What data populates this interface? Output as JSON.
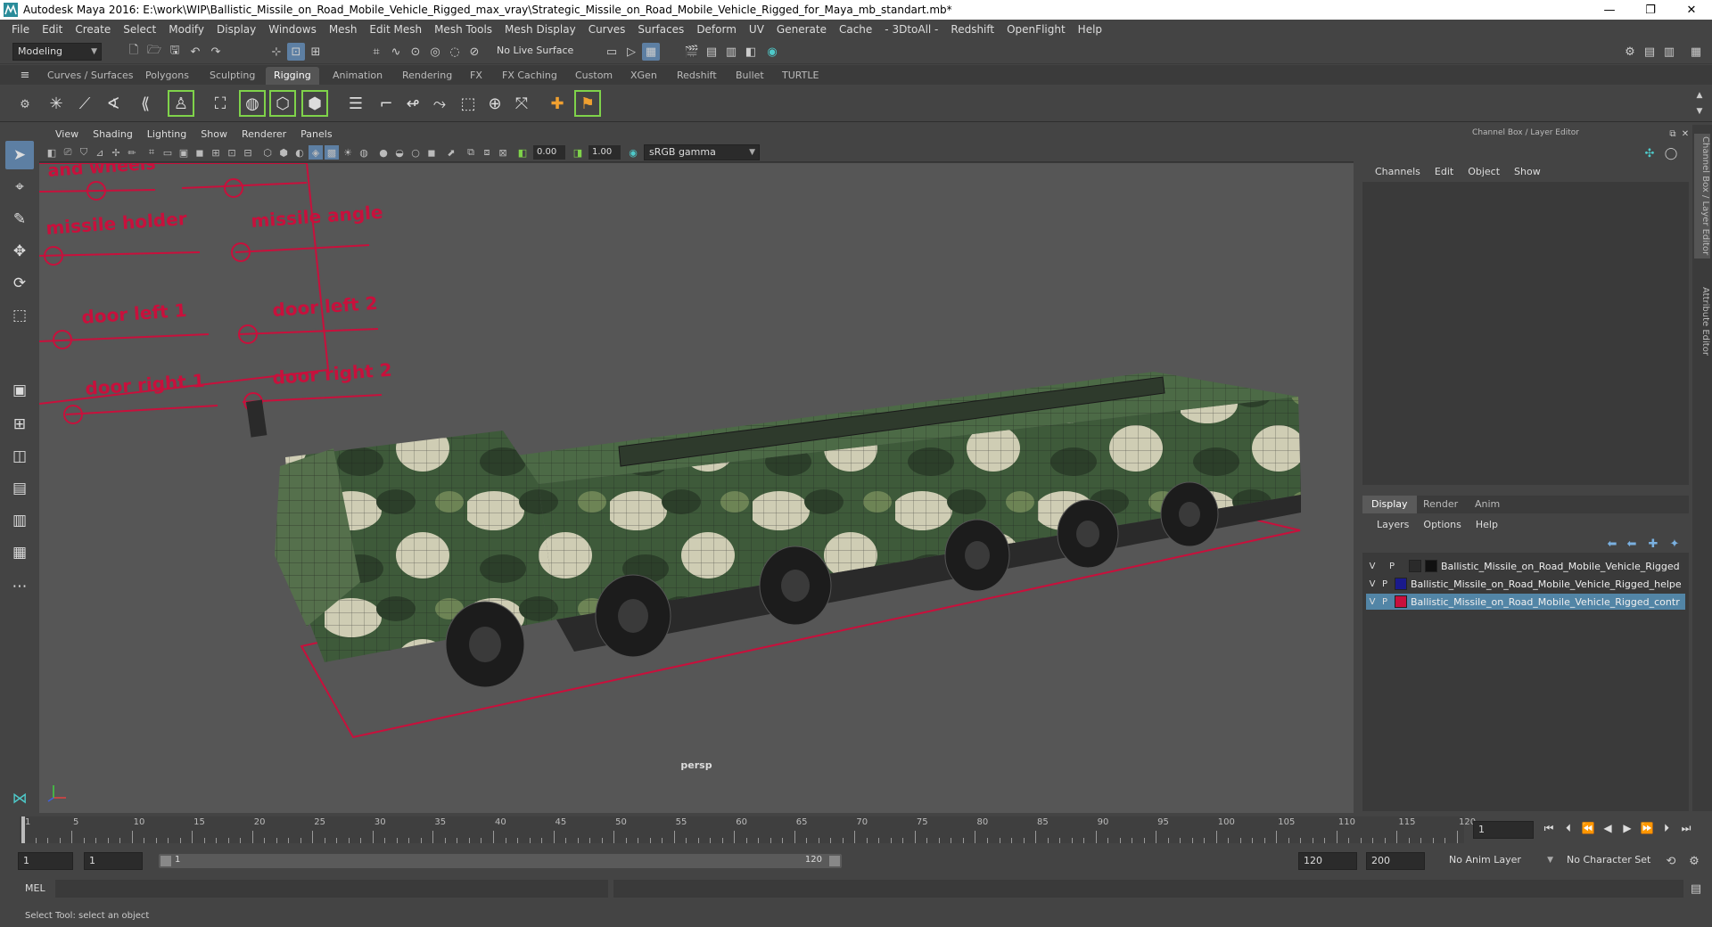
{
  "window": {
    "title": "Autodesk Maya 2016: E:\\work\\WIP\\Ballistic_Missile_on_Road_Mobile_Vehicle_Rigged_max_vray\\Strategic_Missile_on_Road_Mobile_Vehicle_Rigged_for_Maya_mb_standart.mb*",
    "minimize": "—",
    "maximize": "❐",
    "close": "✕"
  },
  "menubar": [
    "File",
    "Edit",
    "Create",
    "Select",
    "Modify",
    "Display",
    "Windows",
    "Mesh",
    "Edit Mesh",
    "Mesh Tools",
    "Mesh Display",
    "Curves",
    "Surfaces",
    "Deform",
    "UV",
    "Generate",
    "Cache",
    "- 3DtoAll -",
    "Redshift",
    "OpenFlight",
    "Help"
  ],
  "statusline": {
    "mode": "Modeling",
    "live_surface": "No Live Surface"
  },
  "shelf_tabs": [
    "Curves / Surfaces",
    "Polygons",
    "Sculpting",
    "Rigging",
    "Animation",
    "Rendering",
    "FX",
    "FX Caching",
    "Custom",
    "XGen",
    "Redshift",
    "Bullet",
    "TURTLE"
  ],
  "shelf_active_tab": "Rigging",
  "viewport": {
    "menu": [
      "View",
      "Shading",
      "Lighting",
      "Show",
      "Renderer",
      "Panels"
    ],
    "exposure": "0.00",
    "gamma": "1.00",
    "color_space": "sRGB gamma",
    "camera": "persp",
    "control_labels": [
      "and wheels",
      "missile holder",
      "missile angle",
      "door left 1",
      "door left 2",
      "door right 1",
      "door right 2"
    ]
  },
  "channel_box": {
    "title": "Channel Box / Layer Editor",
    "menu": [
      "Channels",
      "Edit",
      "Object",
      "Show"
    ]
  },
  "layer_editor": {
    "tabs": [
      "Display",
      "Render",
      "Anim"
    ],
    "active_tab": "Display",
    "menu": [
      "Layers",
      "Options",
      "Help"
    ],
    "layers": [
      {
        "v": "V",
        "p": "P",
        "color": "#111111",
        "name": "Ballistic_Missile_on_Road_Mobile_Vehicle_Rigged",
        "selected": false
      },
      {
        "v": "V",
        "p": "P",
        "color": "#1a1a8c",
        "name": "Ballistic_Missile_on_Road_Mobile_Vehicle_Rigged_helpe",
        "selected": false
      },
      {
        "v": "V",
        "p": "P",
        "color": "#c8103c",
        "name": "Ballistic_Missile_on_Road_Mobile_Vehicle_Rigged_contr",
        "selected": true
      }
    ]
  },
  "side_tabs": [
    "Channel Box / Layer Editor",
    "Attribute Editor"
  ],
  "timeline": {
    "ticks": [
      "1",
      "5",
      "10",
      "15",
      "20",
      "25",
      "30",
      "35",
      "40",
      "45",
      "50",
      "55",
      "60",
      "65",
      "70",
      "75",
      "80",
      "85",
      "90",
      "95",
      "100",
      "105",
      "110",
      "115",
      "120"
    ],
    "current_frame": "1"
  },
  "range": {
    "start": "1",
    "playback_start": "1",
    "range_start_label": "1",
    "range_end_label": "120",
    "playback_end": "120",
    "end": "200",
    "anim_layer": "No Anim Layer",
    "character_set": "No Character Set"
  },
  "cmdline": {
    "lang": "MEL"
  },
  "helpline": "Select Tool: select an object"
}
